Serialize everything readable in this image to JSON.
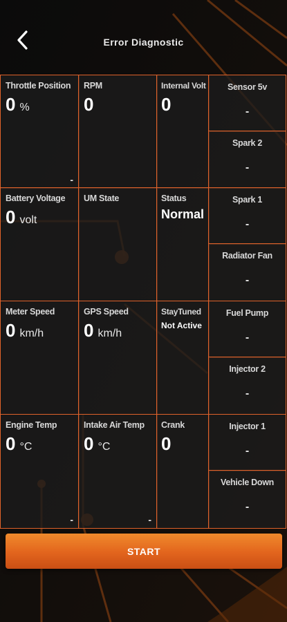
{
  "header": {
    "title": "Error Diagnostic"
  },
  "tiles": {
    "throttle": {
      "label": "Throttle Position",
      "value": "0",
      "unit": "%",
      "dash": "-"
    },
    "rpm": {
      "label": "RPM",
      "value": "0"
    },
    "internal_volt": {
      "label": "Internal Volt",
      "value": "0"
    },
    "battery": {
      "label": "Battery Voltage",
      "value": "0",
      "unit": "volt"
    },
    "um_state": {
      "label": "UM State"
    },
    "status": {
      "label": "Status",
      "value": "Normal"
    },
    "meter_speed": {
      "label": "Meter Speed",
      "value": "0",
      "unit": "km/h"
    },
    "gps_speed": {
      "label": "GPS Speed",
      "value": "0",
      "unit": "km/h"
    },
    "stay_tuned": {
      "label": "StayTuned",
      "value": "Not Active"
    },
    "engine_temp": {
      "label": "Engine Temp",
      "value": "0",
      "unit": "°C",
      "dash": "-"
    },
    "intake_air_temp": {
      "label": "Intake Air Temp",
      "value": "0",
      "unit": "°C",
      "dash": "-"
    },
    "crank": {
      "label": "Crank",
      "value": "0"
    }
  },
  "side": [
    {
      "label": "Sensor 5v",
      "value": "-"
    },
    {
      "label": "Spark 2",
      "value": "-"
    },
    {
      "label": "Spark 1",
      "value": "-"
    },
    {
      "label": "Radiator Fan",
      "value": "-"
    },
    {
      "label": "Fuel Pump",
      "value": "-"
    },
    {
      "label": "Injector 2",
      "value": "-"
    },
    {
      "label": "Injector 1",
      "value": "-"
    },
    {
      "label": "Vehicle Down",
      "value": "-"
    }
  ],
  "actions": {
    "start": "START"
  },
  "colors": {
    "accent": "#e0622a",
    "button": "#e8741f",
    "background": "#0b0b0b"
  }
}
